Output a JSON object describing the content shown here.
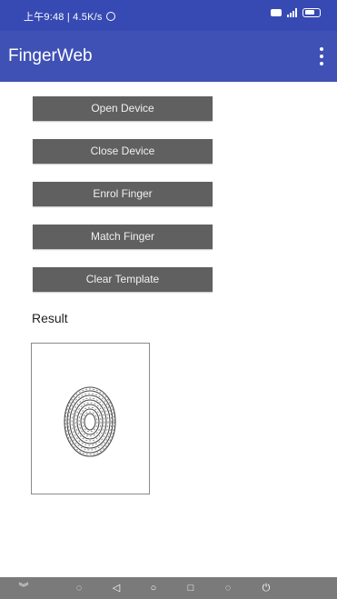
{
  "status_bar": {
    "time_info": "上午9:48 | 4.5K/s"
  },
  "app_bar": {
    "title": "FingerWeb"
  },
  "buttons": {
    "open_device": "Open Device",
    "close_device": "Close Device",
    "enrol_finger": "Enrol Finger",
    "match_finger": "Match Finger",
    "clear_template": "Clear Template"
  },
  "result": {
    "label": "Result"
  },
  "colors": {
    "status_bar": "#3749b3",
    "app_bar": "#3f51b5",
    "button": "#606060",
    "nav_bar": "#7a7a7a"
  },
  "icons": [
    "alarm-icon",
    "message-icon",
    "signal-icon",
    "battery-icon",
    "overflow-menu-icon",
    "fingerprint-image"
  ]
}
